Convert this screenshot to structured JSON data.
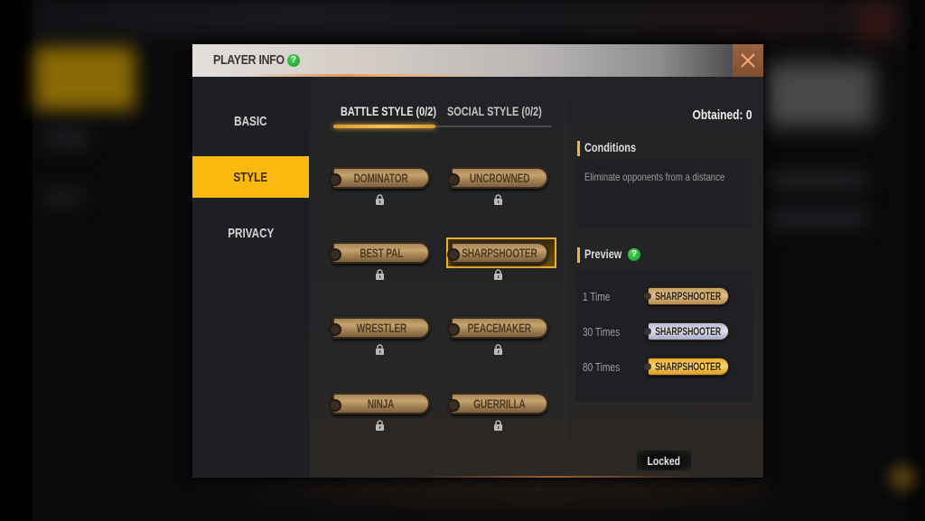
{
  "dialog": {
    "title": "PLAYER INFO",
    "help_icon": "?",
    "close_icon": "close-x"
  },
  "sidebar": {
    "items": [
      {
        "label": "BASIC",
        "active": false
      },
      {
        "label": "STYLE",
        "active": true
      },
      {
        "label": "PRIVACY",
        "active": false
      }
    ]
  },
  "tabs": [
    {
      "label": "BATTLE STYLE (0/2)",
      "active": true
    },
    {
      "label": "SOCIAL STYLE (0/2)",
      "active": false
    }
  ],
  "styles": [
    {
      "label": "DOMINATOR",
      "locked": true,
      "selected": false
    },
    {
      "label": "UNCROWNED",
      "locked": true,
      "selected": false
    },
    {
      "label": "BEST PAL",
      "locked": true,
      "selected": false
    },
    {
      "label": "SHARPSHOOTER",
      "locked": true,
      "selected": true
    },
    {
      "label": "WRESTLER",
      "locked": true,
      "selected": false
    },
    {
      "label": "PEACEMAKER",
      "locked": true,
      "selected": false
    },
    {
      "label": "NINJA",
      "locked": true,
      "selected": false
    },
    {
      "label": "GUERRILLA",
      "locked": true,
      "selected": false
    }
  ],
  "details": {
    "obtained": "Obtained: 0",
    "conditions_title": "Conditions",
    "conditions_text": "Eliminate opponents from a distance",
    "preview_title": "Preview",
    "preview_help": "?",
    "preview": [
      {
        "label": "1 Time",
        "tag": "SHARPSHOOTER",
        "tier": "bronze"
      },
      {
        "label": "30 Times",
        "tag": "SHARPSHOOTER",
        "tier": "silver"
      },
      {
        "label": "80 Times",
        "tag": "SHARPSHOOTER",
        "tier": "gold"
      }
    ],
    "status_button": "Locked"
  },
  "colors": {
    "accent_yellow": "#fbb90e",
    "close_button": "#8c5838",
    "help_green": "#1fae35",
    "tab_underline": "#f6c354"
  }
}
